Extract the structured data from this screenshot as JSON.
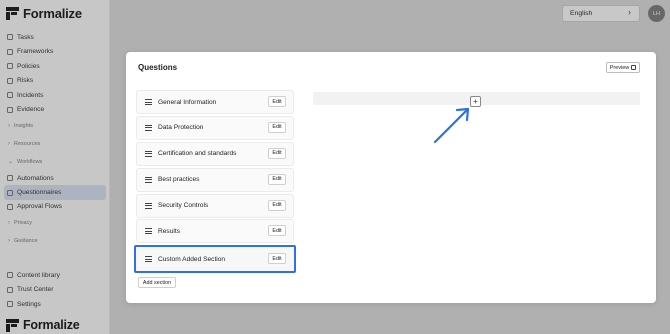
{
  "app": {
    "brand": "Formalize"
  },
  "sidebar": {
    "items": [
      {
        "label": "Tasks",
        "icon": "tasks-icon"
      },
      {
        "label": "Frameworks",
        "icon": "frameworks-icon"
      },
      {
        "label": "Policies",
        "icon": "policies-icon"
      },
      {
        "label": "Risks",
        "icon": "risks-icon"
      },
      {
        "label": "Incidents",
        "icon": "incidents-icon"
      },
      {
        "label": "Evidence",
        "icon": "evidence-icon"
      }
    ],
    "group_insights": "Insights",
    "group_resources": "Resources",
    "group_workflows": "Workflows",
    "workflow_items": [
      {
        "label": "Automations",
        "icon": "automations-icon"
      },
      {
        "label": "Questionnaires",
        "icon": "questionnaires-icon",
        "active": true
      },
      {
        "label": "Approval Flows",
        "icon": "approval-flows-icon"
      }
    ],
    "group_privacy": "Privacy",
    "group_guidance": "Guidance",
    "bottom_items": [
      {
        "label": "Content library",
        "icon": "content-library-icon"
      },
      {
        "label": "Trust Center",
        "icon": "trust-center-icon"
      },
      {
        "label": "Settings",
        "icon": "settings-icon"
      }
    ]
  },
  "header": {
    "language": "English",
    "avatar_initials": "LH"
  },
  "modal": {
    "title": "Questions",
    "preview_label": "Preview",
    "sections": [
      {
        "label": "General Information",
        "edit": "Edit"
      },
      {
        "label": "Data Protection",
        "edit": "Edit"
      },
      {
        "label": "Certification and standards",
        "edit": "Edit"
      },
      {
        "label": "Best practices",
        "edit": "Edit"
      },
      {
        "label": "Security Controls",
        "edit": "Edit"
      },
      {
        "label": "Results",
        "edit": "Edit"
      },
      {
        "label": "Custom Added Section",
        "edit": "Edit",
        "highlighted": true
      }
    ],
    "add_section_label": "Add section",
    "add_question_symbol": "+"
  },
  "colors": {
    "highlight": "#2f6fe8",
    "active_nav": "#d3dcea"
  }
}
